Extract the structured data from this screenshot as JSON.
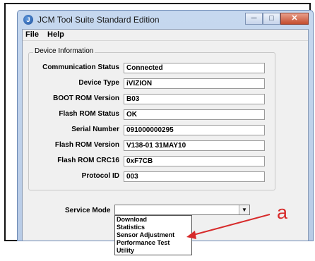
{
  "window": {
    "title": "JCM Tool Suite Standard Edition"
  },
  "menu": [
    "File",
    "Help"
  ],
  "device_info": {
    "legend": "Device Information",
    "rows": [
      {
        "label": "Communication Status",
        "value": "Connected"
      },
      {
        "label": "Device Type",
        "value": "iVIZION"
      },
      {
        "label": "BOOT ROM Version",
        "value": "B03"
      },
      {
        "label": "Flash ROM Status",
        "value": "OK"
      },
      {
        "label": "Serial Number",
        "value": "091000000295"
      },
      {
        "label": "Flash ROM Version",
        "value": "V138-01 31MAY10"
      },
      {
        "label": "Flash ROM CRC16",
        "value": "0xF7CB"
      },
      {
        "label": "Protocol ID",
        "value": "003"
      }
    ]
  },
  "service_mode": {
    "label": "Service Mode",
    "value": "",
    "options": [
      "Download",
      "Statistics",
      "Sensor Adjustment",
      "Performance Test",
      "Utility"
    ]
  },
  "annotation": {
    "label": "a",
    "color": "#d72b2b"
  },
  "icons": {
    "app": "jcm-app-icon",
    "minimize": "minimize-icon",
    "maximize": "maximize-icon",
    "close": "close-icon",
    "dropdown": "chevron-down-icon"
  }
}
